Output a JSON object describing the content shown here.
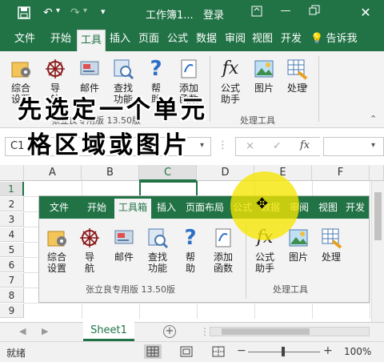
{
  "titlebar": {
    "title": "工作簿1...",
    "login": "登录",
    "colors": {
      "brand": "#217346"
    }
  },
  "tabs": [
    "文件",
    "开始",
    "工具箱",
    "插入",
    "页面",
    "公式",
    "数据",
    "审阅",
    "视图",
    "开发",
    "告诉我"
  ],
  "ribbon": {
    "buttons": [
      {
        "label1": "综合",
        "label2": "设置",
        "icon": "settings-icon"
      },
      {
        "label1": "导",
        "label2": "航",
        "icon": "navigation-wheel-icon"
      },
      {
        "label1": "邮件",
        "label2": "",
        "icon": "mail-icon"
      },
      {
        "label1": "查找",
        "label2": "功能",
        "icon": "find-icon"
      },
      {
        "label1": "帮",
        "label2": "助",
        "icon": "help-icon"
      },
      {
        "label1": "添加",
        "label2": "函数",
        "icon": "add-function-icon"
      },
      {
        "label1": "公式",
        "label2": "助手",
        "icon": "fx-icon"
      },
      {
        "label1": "图片",
        "label2": "",
        "icon": "picture-icon"
      },
      {
        "label1": "处理",
        "label2": "",
        "icon": "process-icon"
      }
    ],
    "group1_label": "张立良专用版 13.50版",
    "group2_label": "处理工具"
  },
  "caption": {
    "line1": "先选定一个单元",
    "line2": "格区域或图片"
  },
  "formula": {
    "namebox": "C1",
    "cancel": "×",
    "enter": "✓",
    "fx": "fx"
  },
  "grid": {
    "columns": [
      "A",
      "B",
      "C",
      "D",
      "E",
      "F"
    ],
    "rows": [
      "1",
      "2",
      "3",
      "4",
      "5",
      "6",
      "7",
      "8",
      "9"
    ]
  },
  "inner": {
    "tabs": [
      "文件",
      "开始",
      "工具箱",
      "插入",
      "页面布局",
      "公式",
      "数据",
      "审阅",
      "视图",
      "开发"
    ],
    "buttons": [
      {
        "label1": "综合",
        "label2": "设置"
      },
      {
        "label1": "导",
        "label2": "航"
      },
      {
        "label1": "邮件",
        "label2": ""
      },
      {
        "label1": "查找",
        "label2": "功能"
      },
      {
        "label1": "帮",
        "label2": "助"
      },
      {
        "label1": "添加",
        "label2": "函数"
      },
      {
        "label1": "公式",
        "label2": "助手"
      },
      {
        "label1": "图片",
        "label2": ""
      },
      {
        "label1": "处理",
        "label2": ""
      }
    ],
    "group1_label": "张立良专用版 13.50版",
    "group2_label": "处理工具"
  },
  "sheets": {
    "active": "Sheet1",
    "add": "+"
  },
  "status": {
    "ready": "就绪",
    "zoom": "100%",
    "minus": "−",
    "plus": "+"
  }
}
